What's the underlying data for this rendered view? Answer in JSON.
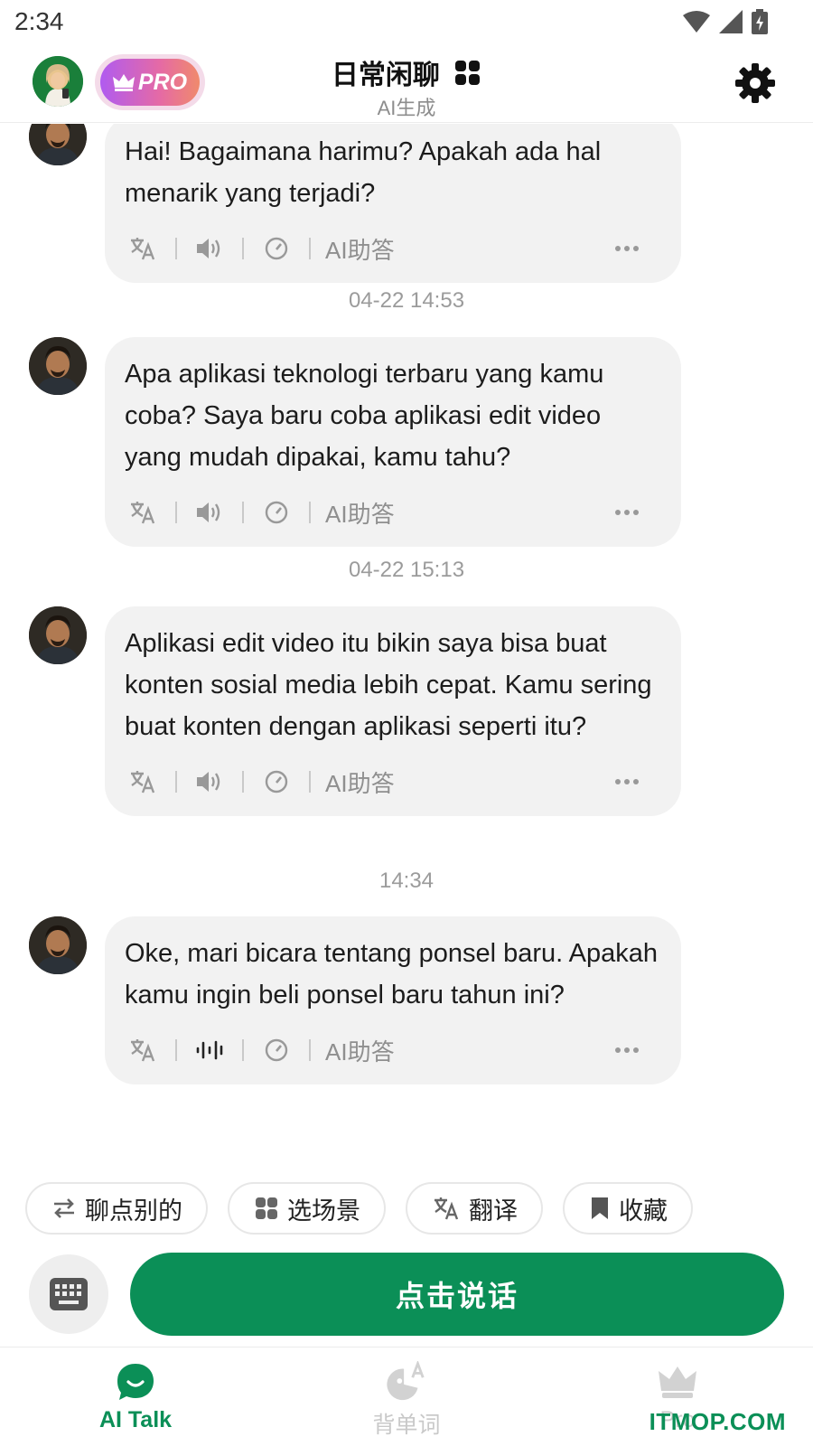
{
  "status_bar": {
    "time": "2:34"
  },
  "header": {
    "pro_label": "PRO",
    "title": "日常闲聊",
    "subtitle": "AI生成"
  },
  "messages": [
    {
      "text": "Hai! Bagaimana harimu? Apakah ada hal menarik yang terjadi?",
      "ai_help": "AI助答",
      "audio_state": "speaker"
    },
    {
      "text": "Apa aplikasi teknologi terbaru yang kamu coba? Saya baru coba aplikasi edit video yang mudah dipakai, kamu tahu?",
      "ai_help": "AI助答",
      "audio_state": "speaker"
    },
    {
      "text": "Aplikasi edit video itu bikin saya bisa buat konten sosial media lebih cepat. Kamu sering buat konten dengan aplikasi seperti itu?",
      "ai_help": "AI助答",
      "audio_state": "speaker"
    },
    {
      "text": "Oke, mari bicara tentang ponsel baru. Apakah kamu ingin beli ponsel baru tahun ini?",
      "ai_help": "AI助答",
      "audio_state": "playing"
    }
  ],
  "timestamps": [
    "04-22 14:53",
    "04-22 15:13",
    "14:34"
  ],
  "quick_actions": [
    {
      "label": "聊点别的",
      "icon": "swap-icon"
    },
    {
      "label": "选场景",
      "icon": "grid-icon"
    },
    {
      "label": "翻译",
      "icon": "translate-icon"
    },
    {
      "label": "收藏",
      "icon": "bookmark-icon"
    }
  ],
  "talk_button": "点击说话",
  "nav": [
    {
      "label": "AI Talk",
      "icon": "chat-bubble-icon",
      "active": true
    },
    {
      "label": "背单词",
      "icon": "vocab-icon",
      "active": false
    },
    {
      "label": "Pro",
      "icon": "crown-icon",
      "active": false
    }
  ],
  "watermark": "ITMOP.COM",
  "colors": {
    "accent": "#0b8f57",
    "bubble": "#f2f2f2",
    "pro_gradient_start": "#b05bf0",
    "pro_gradient_end": "#f08a6c"
  }
}
